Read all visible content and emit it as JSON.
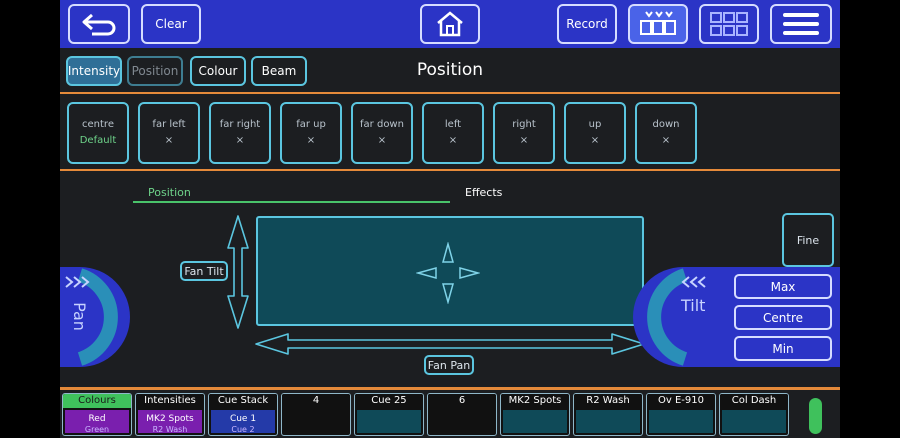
{
  "toolbar": {
    "back_icon": "undo-arrow-icon",
    "clear_label": "Clear",
    "home_icon": "home-icon",
    "record_label": "Record",
    "view_icon": "fixtures-view-icon",
    "grid_icon": "grid-icon",
    "menu_icon": "hamburger-menu-icon"
  },
  "attributes": {
    "intensity": "Intensity",
    "position": "Position",
    "colour": "Colour",
    "beam": "Beam"
  },
  "page_title": "Position",
  "presets": [
    {
      "label": "centre",
      "value": "Default"
    },
    {
      "label": "far left",
      "value": "×"
    },
    {
      "label": "far right",
      "value": "×"
    },
    {
      "label": "far up",
      "value": "×"
    },
    {
      "label": "far down",
      "value": "×"
    },
    {
      "label": "left",
      "value": "×"
    },
    {
      "label": "right",
      "value": "×"
    },
    {
      "label": "up",
      "value": "×"
    },
    {
      "label": "down",
      "value": "×"
    }
  ],
  "tabs": {
    "position": "Position",
    "effects": "Effects"
  },
  "controls": {
    "fan_tilt": "Fan Tilt",
    "fan_pan": "Fan Pan",
    "fine": "Fine",
    "pan": "Pan",
    "tilt": "Tilt",
    "max": "Max",
    "centre": "Centre",
    "min": "Min"
  },
  "playbacks": [
    {
      "label": "Colours",
      "line1": "Red",
      "line2": "Green",
      "style": "purple",
      "head": "green"
    },
    {
      "label": "Intensities",
      "line1": "MK2 Spots",
      "line2": "R2 Wash",
      "style": "purple",
      "head": ""
    },
    {
      "label": "Cue Stack",
      "line1": "Cue 1",
      "line2": "Cue 2",
      "style": "blue",
      "head": ""
    },
    {
      "label": "4",
      "line1": "",
      "line2": "",
      "style": "dark",
      "head": ""
    },
    {
      "label": "Cue 25",
      "line1": "",
      "line2": "",
      "style": "teal",
      "head": ""
    },
    {
      "label": "6",
      "line1": "",
      "line2": "",
      "style": "dark",
      "head": ""
    },
    {
      "label": "MK2 Spots",
      "line1": "",
      "line2": "",
      "style": "teal",
      "head": ""
    },
    {
      "label": "R2 Wash",
      "line1": "",
      "line2": "",
      "style": "teal",
      "head": ""
    },
    {
      "label": "Ov E-910",
      "line1": "",
      "line2": "",
      "style": "teal",
      "head": ""
    },
    {
      "label": "Col Dash",
      "line1": "",
      "line2": "",
      "style": "teal",
      "head": ""
    }
  ],
  "colors": {
    "toolbar_blue": "#2b34c6",
    "accent_cyan": "#5bc6e0",
    "separator_orange": "#e58a3a",
    "active_green": "#49c36a"
  }
}
